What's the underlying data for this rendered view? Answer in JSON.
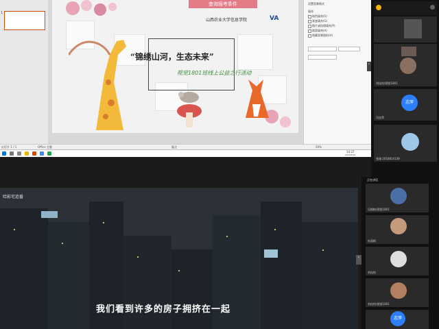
{
  "top": {
    "slide": {
      "query_button": "查询报考条件",
      "logo_text": "山西农业大学信息学院",
      "logo_va": "VA",
      "title": "“锦绣山河，生态未来”",
      "subtitle": "视觉1801班线上公益之行活动"
    },
    "thumbnail_number": "1",
    "statusbar": {
      "left": "幻灯片 1 / 1",
      "lang": "Office 主题",
      "notes": "备注",
      "zoom": "59%"
    },
    "taskbar_time": "14:27",
    "taskbar_date": "2020/5/31",
    "side_pane": [
      "设置背景格式",
      "填充",
      "纯色填充(S)",
      "渐变填充(G)",
      "图片或纹理填充(P)",
      "图案填充(A)",
      "隐藏背景图形(H)"
    ]
  },
  "participants_top": [
    {
      "name": "",
      "type": "video"
    },
    {
      "name": "杜雨帆",
      "type": "video"
    },
    {
      "name": "刘佳怡(视觉1801",
      "type": "video"
    },
    {
      "name": "冯志萍",
      "type": "avatar",
      "avatar_text": "志萍",
      "color": "#2d7ff9"
    },
    {
      "name": "张瑞 2018814139",
      "type": "avatar",
      "avatar_text": "",
      "color": "#9ec6e8"
    }
  ],
  "video": {
    "watermark": "哈影宅追番",
    "subtitle": "我们看到许多的房子拥挤在一起"
  },
  "speaking_label": "正在讲话",
  "participants_bottom": [
    {
      "name": "冯知柏(视觉1801",
      "color": "#4a6fa5"
    },
    {
      "name": "杜雨帆",
      "color": "#c59a7a"
    },
    {
      "name": "刘佳怡",
      "color": "#dddddd"
    },
    {
      "name": "刘佳怡(视觉1801",
      "color": "#b08060"
    },
    {
      "name": "",
      "avatar_text": "志萍",
      "color": "#2d7ff9"
    }
  ],
  "icons": [
    "search-icon",
    "microphone-icon",
    "chevron-right-icon",
    "chevron-left-icon"
  ]
}
